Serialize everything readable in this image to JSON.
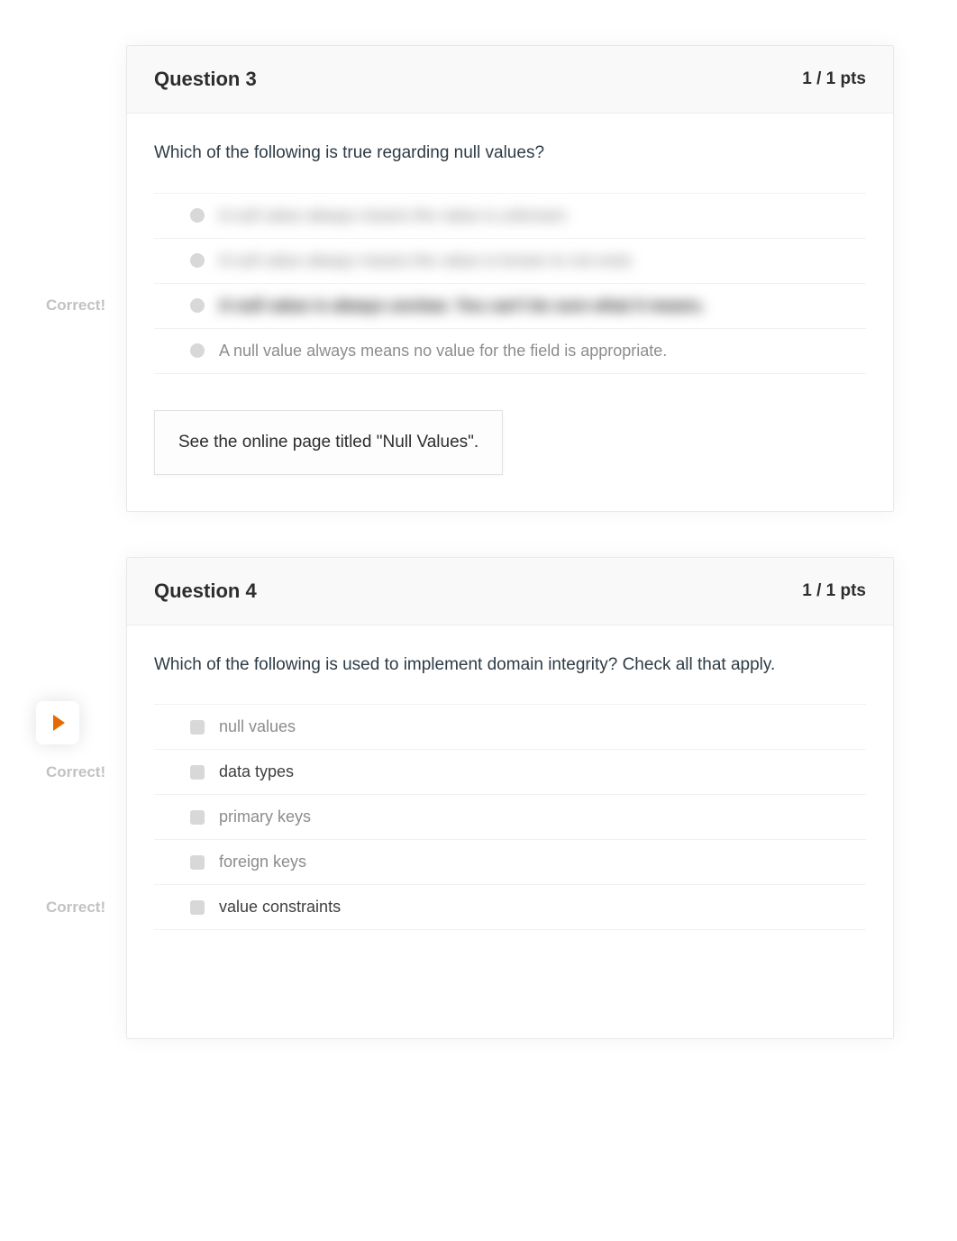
{
  "labels": {
    "correct": "Correct!"
  },
  "q3": {
    "title": "Question 3",
    "pts": "1 / 1 pts",
    "prompt": "Which of the following is true regarding null values?",
    "answers": [
      {
        "text": "A null value always means the value is unknown."
      },
      {
        "text": "A null value always means the value is known to not exist."
      },
      {
        "text": "A null value is always unclear. You can't be sure what it means."
      },
      {
        "text": "A null value always means no value for the field is appropriate."
      }
    ],
    "feedback": "See the online page titled \"Null Values\"."
  },
  "q4": {
    "title": "Question 4",
    "pts": "1 / 1 pts",
    "prompt": "Which of the following is used to implement domain integrity? Check all that apply.",
    "answers": [
      {
        "text": "null values"
      },
      {
        "text": "data types"
      },
      {
        "text": "primary keys"
      },
      {
        "text": "foreign keys"
      },
      {
        "text": "value constraints"
      }
    ]
  }
}
